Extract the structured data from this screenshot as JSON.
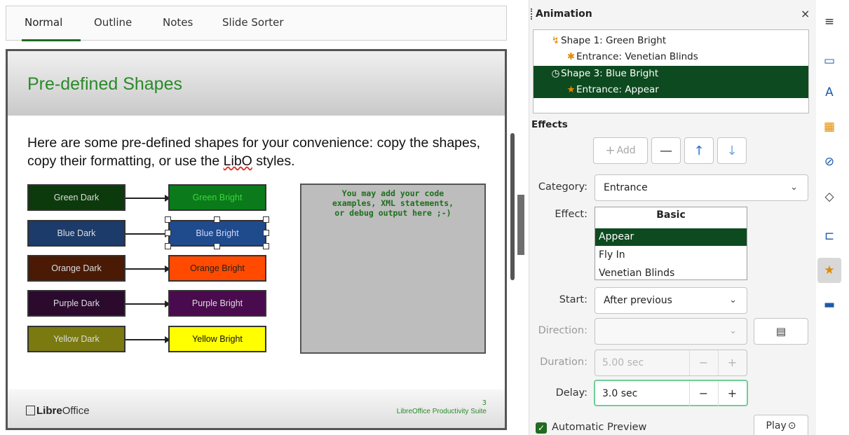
{
  "tabs": [
    "Normal",
    "Outline",
    "Notes",
    "Slide Sorter"
  ],
  "slide": {
    "title": "Pre-defined Shapes",
    "body_before": "Here are some pre-defined shapes for your convenience: copy the shapes, copy their formatting, or use the ",
    "body_libo": "LibO",
    "body_after": " styles.",
    "shapes_dark": [
      "Green Dark",
      "Blue Dark",
      "Orange Dark",
      "Purple Dark",
      "Yellow Dark"
    ],
    "shapes_bright": [
      "Green Bright",
      "Blue Bright",
      "Orange Bright",
      "Purple Bright",
      "Yellow Bright"
    ],
    "code_text": "You may add your code\nexamples, XML statements,\nor debug output here ;-)",
    "footer_logo_bold": "Libre",
    "footer_logo_rest": "Office",
    "footer_suite": "LibreOffice Productivity Suite",
    "page_number": "3"
  },
  "panel": {
    "title": "Animation",
    "close": "×",
    "animations": [
      {
        "label": "Shape 1: Green Bright",
        "selected": false
      },
      {
        "label": "Entrance: Venetian Blinds",
        "selected": false
      },
      {
        "label": "Shape 3: Blue Bright",
        "selected": true
      },
      {
        "label": "Entrance: Appear",
        "selected": true
      }
    ],
    "effects_label": "Effects",
    "add_label": "Add",
    "category_label": "Category:",
    "category_value": "Entrance",
    "effect_label": "Effect:",
    "effect_group": "Basic",
    "effect_items": [
      "Appear",
      "Fly In",
      "Venetian Blinds"
    ],
    "start_label": "Start:",
    "start_value": "After previous",
    "direction_label": "Direction:",
    "direction_value": "",
    "duration_label": "Duration:",
    "duration_value": "5.00 sec",
    "delay_label": "Delay:",
    "delay_value": "3.0 sec",
    "auto_preview_label": "Automatic Preview",
    "play_label": "Play"
  }
}
